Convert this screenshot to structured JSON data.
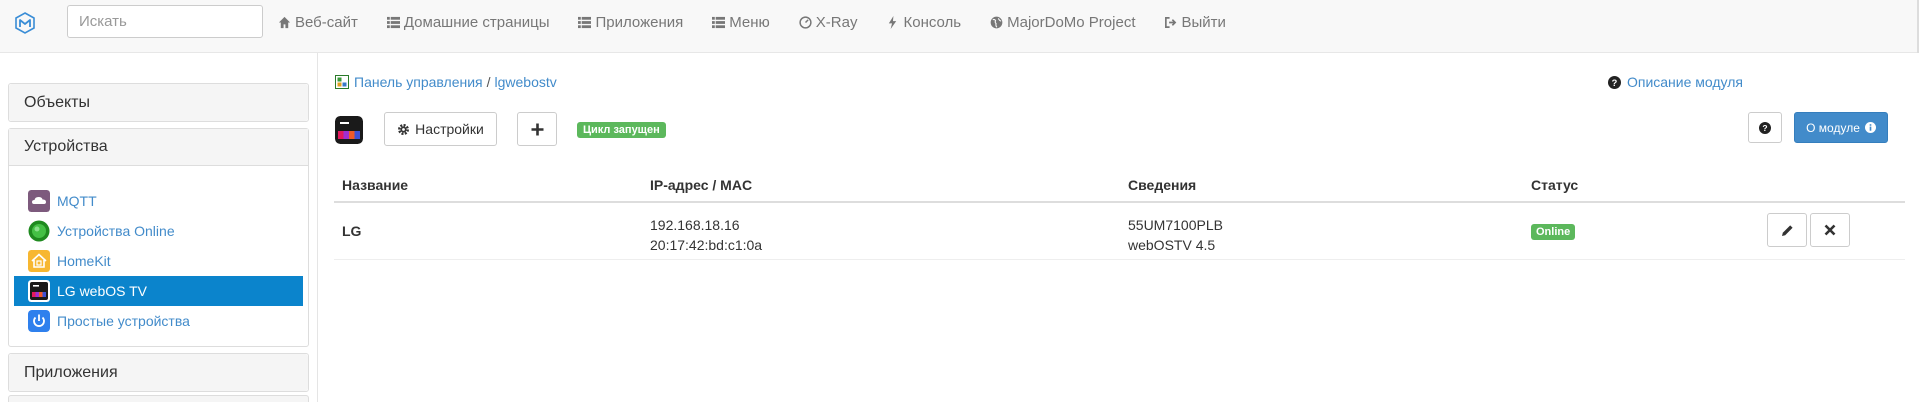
{
  "navbar": {
    "brand_icon": "majordomo-logo-icon",
    "search_placeholder": "Искать",
    "links": [
      {
        "label": "Веб-сайт",
        "icon": "home-icon"
      },
      {
        "label": "Домашние страницы",
        "icon": "list-icon"
      },
      {
        "label": "Приложения",
        "icon": "list-icon"
      },
      {
        "label": "Меню",
        "icon": "list-icon"
      },
      {
        "label": "X-Ray",
        "icon": "gauge-icon"
      },
      {
        "label": "Консоль",
        "icon": "flash-icon"
      },
      {
        "label": "MajorDoMo Project",
        "icon": "globe-icon"
      },
      {
        "label": "Выйти",
        "icon": "logout-icon"
      }
    ]
  },
  "sidebar": {
    "panels": [
      {
        "label": "Объекты",
        "expanded": false
      },
      {
        "label": "Устройства",
        "expanded": true
      },
      {
        "label": "Приложения",
        "expanded": false
      }
    ],
    "devices": [
      {
        "label": "MQTT",
        "icon": "mqtt-cloud-icon",
        "active": false
      },
      {
        "label": "Устройства Online",
        "icon": "online-globe-icon",
        "active": false
      },
      {
        "label": "HomeKit",
        "icon": "homekit-house-icon",
        "active": false
      },
      {
        "label": "LG webOS TV",
        "icon": "webos-tv-icon",
        "active": true
      },
      {
        "label": "Простые устройства",
        "icon": "power-icon",
        "active": false
      }
    ]
  },
  "main": {
    "breadcrumb": {
      "root": "Панель управления",
      "separator": "/",
      "current": "lgwebostv"
    },
    "help_link": "Описание модуля",
    "settings_label": "Настройки",
    "cycle_badge": "Цикл запущен",
    "about_label": "О модуле"
  },
  "table": {
    "headers": [
      "Название",
      "IP-адрес / MAC",
      "Сведения",
      "Статус"
    ],
    "rows": [
      {
        "name": "LG",
        "ip": "192.168.18.16",
        "mac": "20:17:42:bd:c1:0a",
        "model": "55UM7100PLB",
        "os": "webOSTV 4.5",
        "status": "Online"
      }
    ]
  },
  "colors": {
    "accent": "#428bca",
    "active_item": "#0b84cc",
    "success": "#5cb85c",
    "navbar_bg": "#f8f8f8"
  }
}
